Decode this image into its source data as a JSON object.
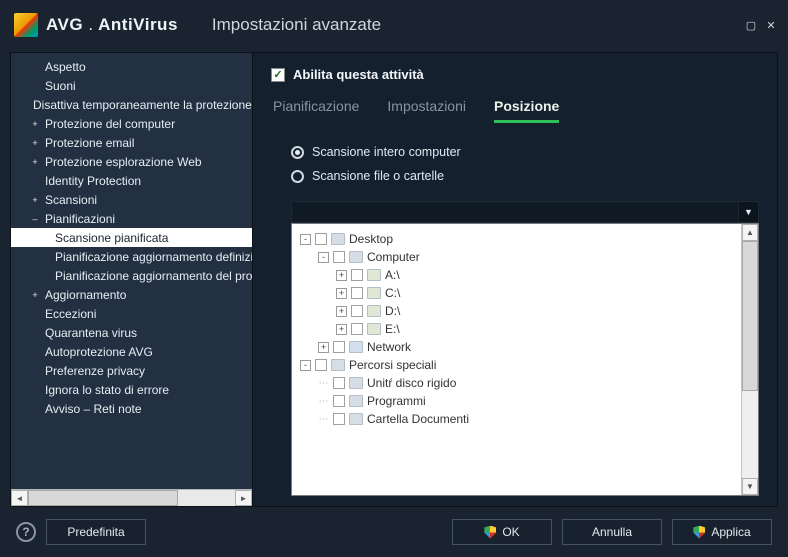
{
  "window": {
    "brand_prefix": "AVG",
    "brand_suffix": "AntiVirus",
    "title": "Impostazioni avanzate"
  },
  "sidebar": {
    "items": [
      {
        "label": "Aspetto",
        "depth": 1,
        "expander": "",
        "selected": false
      },
      {
        "label": "Suoni",
        "depth": 1,
        "expander": "",
        "selected": false
      },
      {
        "label": "Disattiva temporaneamente la protezione",
        "depth": 1,
        "expander": "",
        "selected": false
      },
      {
        "label": "Protezione del computer",
        "depth": 1,
        "expander": "+",
        "selected": false
      },
      {
        "label": "Protezione email",
        "depth": 1,
        "expander": "+",
        "selected": false
      },
      {
        "label": "Protezione esplorazione Web",
        "depth": 1,
        "expander": "+",
        "selected": false
      },
      {
        "label": "Identity Protection",
        "depth": 1,
        "expander": "",
        "selected": false
      },
      {
        "label": "Scansioni",
        "depth": 1,
        "expander": "+",
        "selected": false
      },
      {
        "label": "Pianificazioni",
        "depth": 1,
        "expander": "–",
        "selected": false
      },
      {
        "label": "Scansione pianificata",
        "depth": 2,
        "expander": "",
        "selected": true
      },
      {
        "label": "Pianificazione aggiornamento definizioni",
        "depth": 2,
        "expander": "",
        "selected": false
      },
      {
        "label": "Pianificazione aggiornamento del programma",
        "depth": 2,
        "expander": "",
        "selected": false
      },
      {
        "label": "Aggiornamento",
        "depth": 1,
        "expander": "+",
        "selected": false
      },
      {
        "label": "Eccezioni",
        "depth": 1,
        "expander": "",
        "selected": false
      },
      {
        "label": "Quarantena virus",
        "depth": 1,
        "expander": "",
        "selected": false
      },
      {
        "label": "Autoprotezione AVG",
        "depth": 1,
        "expander": "",
        "selected": false
      },
      {
        "label": "Preferenze privacy",
        "depth": 1,
        "expander": "",
        "selected": false
      },
      {
        "label": "Ignora lo stato di errore",
        "depth": 1,
        "expander": "",
        "selected": false
      },
      {
        "label": "Avviso – Reti note",
        "depth": 1,
        "expander": "",
        "selected": false
      }
    ]
  },
  "main": {
    "enable_checkbox": {
      "checked": true,
      "label": "Abilita questa attività"
    },
    "tabs": [
      {
        "label": "Pianificazione",
        "active": false
      },
      {
        "label": "Impostazioni",
        "active": false
      },
      {
        "label": "Posizione",
        "active": true
      }
    ],
    "radios": [
      {
        "label": "Scansione intero computer",
        "checked": true
      },
      {
        "label": "Scansione file o cartelle",
        "checked": false
      }
    ],
    "filetree": [
      {
        "depth": 0,
        "expander": "-",
        "checkbox": true,
        "icon": "folder",
        "label": "Desktop"
      },
      {
        "depth": 1,
        "expander": "-",
        "checkbox": true,
        "icon": "folder",
        "label": "Computer"
      },
      {
        "depth": 2,
        "expander": "+",
        "checkbox": true,
        "icon": "drive",
        "label": "A:\\"
      },
      {
        "depth": 2,
        "expander": "+",
        "checkbox": true,
        "icon": "drive",
        "label": "C:\\"
      },
      {
        "depth": 2,
        "expander": "+",
        "checkbox": true,
        "icon": "drive",
        "label": "D:\\"
      },
      {
        "depth": 2,
        "expander": "+",
        "checkbox": true,
        "icon": "drive",
        "label": "E:\\"
      },
      {
        "depth": 1,
        "expander": "+",
        "checkbox": true,
        "icon": "net",
        "label": "Network"
      },
      {
        "depth": 0,
        "expander": "-",
        "checkbox": true,
        "icon": "folder",
        "label": "Percorsi speciali"
      },
      {
        "depth": 1,
        "expander": "",
        "checkbox": true,
        "icon": "folder",
        "label": "Unitŕ disco rigido"
      },
      {
        "depth": 1,
        "expander": "",
        "checkbox": true,
        "icon": "folder",
        "label": "Programmi"
      },
      {
        "depth": 1,
        "expander": "",
        "checkbox": true,
        "icon": "folder",
        "label": "Cartella Documenti"
      }
    ]
  },
  "footer": {
    "default_btn": "Predefinita",
    "ok_btn": "OK",
    "cancel_btn": "Annulla",
    "apply_btn": "Applica"
  }
}
